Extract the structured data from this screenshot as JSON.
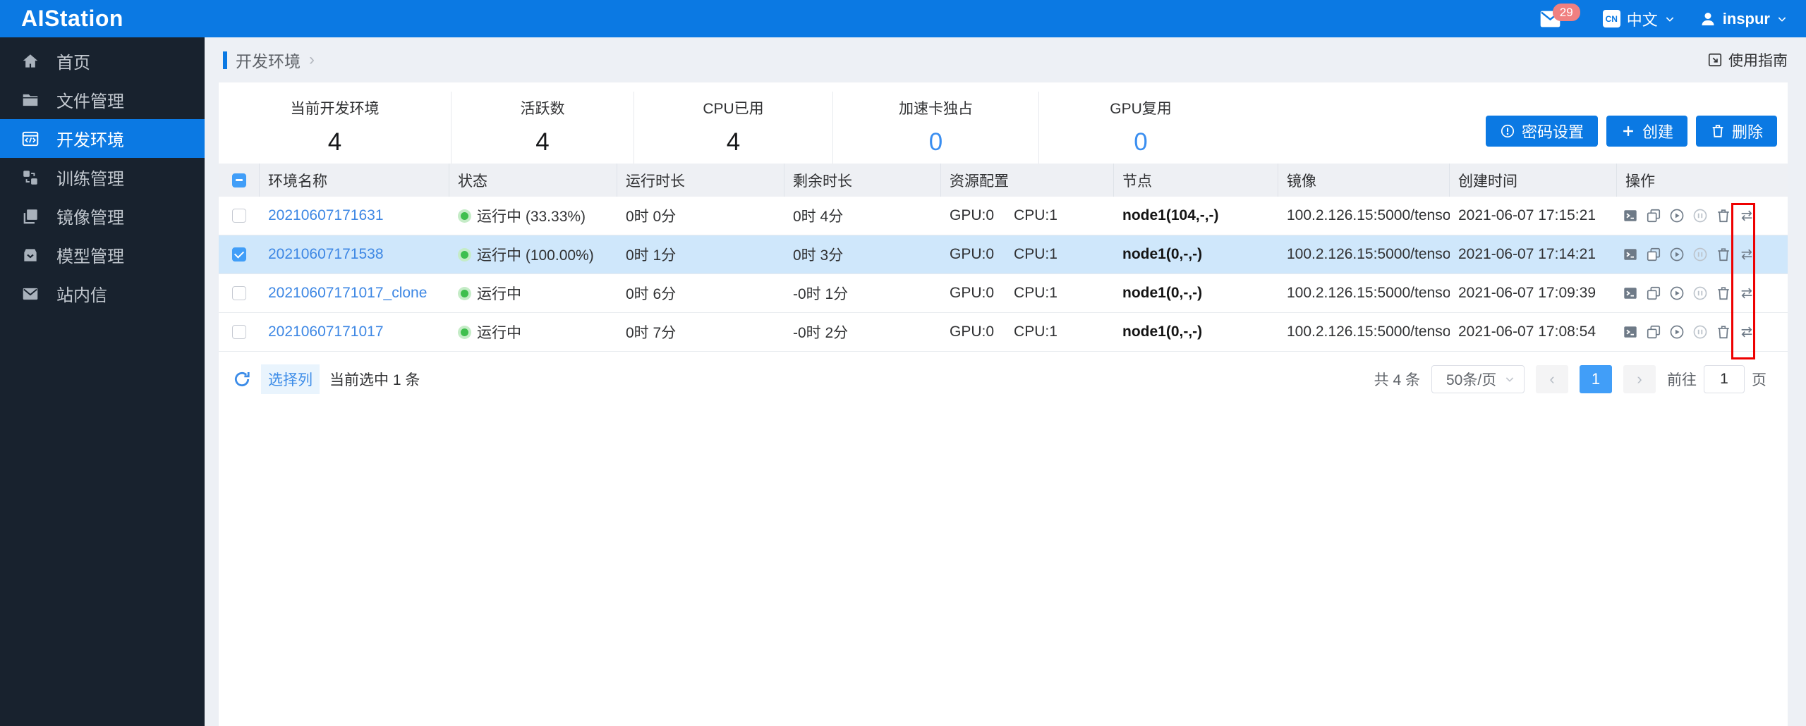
{
  "topbar": {
    "logo": "AIStation",
    "mail_badge": "29",
    "lang_icon": "CN",
    "lang": "中文",
    "user": "inspur"
  },
  "sidebar": {
    "items": [
      {
        "label": "首页",
        "icon": "home-icon",
        "active": false
      },
      {
        "label": "文件管理",
        "icon": "folder-icon",
        "active": false
      },
      {
        "label": "开发环境",
        "icon": "code-window-icon",
        "active": true
      },
      {
        "label": "训练管理",
        "icon": "training-icon",
        "active": false
      },
      {
        "label": "镜像管理",
        "icon": "layers-icon",
        "active": false
      },
      {
        "label": "模型管理",
        "icon": "model-box-icon",
        "active": false
      },
      {
        "label": "站内信",
        "icon": "envelope-icon",
        "active": false
      }
    ]
  },
  "breadcrumb": {
    "current": "开发环境"
  },
  "guide_link": "使用指南",
  "stats": [
    {
      "label": "当前开发环境",
      "value": "4",
      "blue": false
    },
    {
      "label": "活跃数",
      "value": "4",
      "blue": false
    },
    {
      "label": "CPU已用",
      "value": "4",
      "blue": false
    },
    {
      "label": "加速卡独占",
      "value": "0",
      "blue": true
    },
    {
      "label": "GPU复用",
      "value": "0",
      "blue": true
    }
  ],
  "actions": {
    "password": "密码设置",
    "create": "创建",
    "delete": "删除"
  },
  "table": {
    "columns": [
      "环境名称",
      "状态",
      "运行时长",
      "剩余时长",
      "资源配置",
      "节点",
      "镜像",
      "创建时间",
      "操作"
    ],
    "rows": [
      {
        "name": "20210607171631",
        "status": "运行中 (33.33%)",
        "runtime": "0时 0分",
        "remaining": "0时 4分",
        "gpu": "GPU:0",
        "cpu": "CPU:1",
        "node": "node1(104,-,-)",
        "image": "100.2.126.15:5000/tensor...",
        "created": "2021-06-07 17:15:21",
        "checked": false,
        "selected": false
      },
      {
        "name": "20210607171538",
        "status": "运行中 (100.00%)",
        "runtime": "0时 1分",
        "remaining": "0时 3分",
        "gpu": "GPU:0",
        "cpu": "CPU:1",
        "node": "node1(0,-,-)",
        "image": "100.2.126.15:5000/tensor...",
        "created": "2021-06-07 17:14:21",
        "checked": true,
        "selected": true
      },
      {
        "name": "20210607171017_clone",
        "status": "运行中",
        "runtime": "0时 6分",
        "remaining": "-0时 1分",
        "gpu": "GPU:0",
        "cpu": "CPU:1",
        "node": "node1(0,-,-)",
        "image": "100.2.126.15:5000/tensor...",
        "created": "2021-06-07 17:09:39",
        "checked": false,
        "selected": false
      },
      {
        "name": "20210607171017",
        "status": "运行中",
        "runtime": "0时 7分",
        "remaining": "-0时 2分",
        "gpu": "GPU:0",
        "cpu": "CPU:1",
        "node": "node1(0,-,-)",
        "image": "100.2.126.15:5000/tensor...",
        "created": "2021-06-07 17:08:54",
        "checked": false,
        "selected": false
      }
    ],
    "operation_icons": [
      "terminal-icon",
      "clone-icon",
      "start-icon",
      "pause-icon",
      "delete-icon",
      "transfer-icon"
    ]
  },
  "footer": {
    "select_columns": "选择列",
    "selected_info": "当前选中 1 条",
    "total": "共 4 条",
    "page_size": "50条/页",
    "prev_label": "‹",
    "current_page": "1",
    "next_label": "›",
    "goto_prefix": "前往",
    "goto_value": "1",
    "goto_suffix": "页"
  },
  "colors": {
    "primary_blue": "#0b79e3",
    "link_blue": "#3d87e4",
    "stat_blue": "#3a8ef0",
    "selected_row": "#cfe7fb",
    "status_green": "#3fbf4e",
    "badge_red": "#f08080",
    "annotation_red": "#ee0000",
    "sidebar_bg": "#18222e"
  }
}
